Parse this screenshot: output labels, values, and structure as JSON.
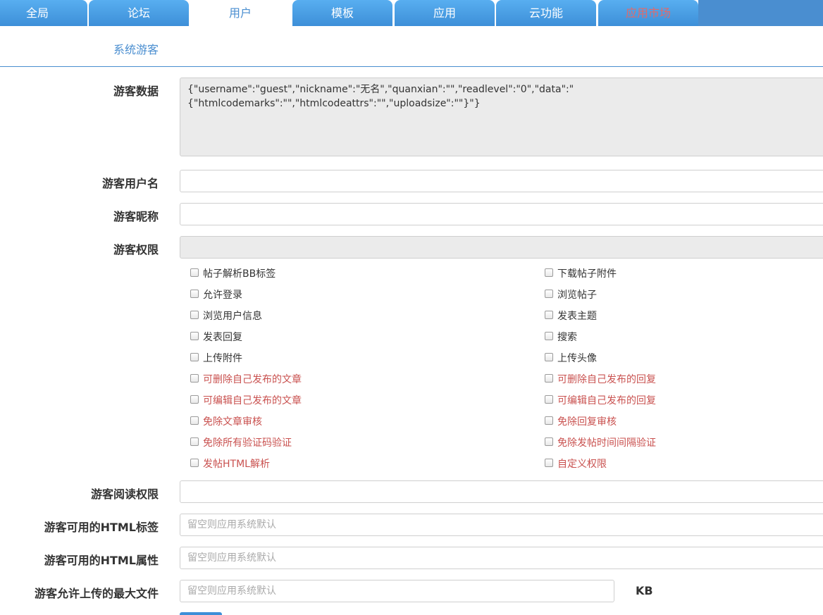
{
  "tabs": [
    {
      "label": "全局",
      "name": "tab-global"
    },
    {
      "label": "论坛",
      "name": "tab-forum"
    },
    {
      "label": "用户",
      "name": "tab-users"
    },
    {
      "label": "模板",
      "name": "tab-templates"
    },
    {
      "label": "应用",
      "name": "tab-apps"
    },
    {
      "label": "云功能",
      "name": "tab-cloud"
    },
    {
      "label": "应用市场",
      "name": "tab-app-market"
    }
  ],
  "active_tab": "用户",
  "section_title": "系统游客",
  "form": {
    "guest_data_label": "游客数据",
    "guest_data_value": "{\"username\":\"guest\",\"nickname\":\"无名\",\"quanxian\":\"\",\"readlevel\":\"0\",\"data\":\"{\"htmlcodemarks\":\"\",\"htmlcodeattrs\":\"\",\"uploadsize\":\"\"}\"}",
    "username_label": "游客用户名",
    "username_value": "",
    "nickname_label": "游客昵称",
    "nickname_value": "",
    "permission_label": "游客权限",
    "permission_value": "",
    "read_level_label": "游客阅读权限",
    "read_level_value": "",
    "html_tags_label": "游客可用的HTML标签",
    "html_tags_placeholder": "留空则应用系统默认",
    "html_attrs_label": "游客可用的HTML属性",
    "html_attrs_placeholder": "留空则应用系统默认",
    "max_upload_label": "游客允许上传的最大文件",
    "max_upload_placeholder": "留空则应用系统默认",
    "max_upload_unit": "KB"
  },
  "permissions_left": [
    {
      "label": "帖子解析BB标签",
      "warn": false
    },
    {
      "label": "允许登录",
      "warn": false
    },
    {
      "label": "浏览用户信息",
      "warn": false
    },
    {
      "label": "发表回复",
      "warn": false
    },
    {
      "label": "上传附件",
      "warn": false
    },
    {
      "label": "可删除自己发布的文章",
      "warn": true
    },
    {
      "label": "可编辑自己发布的文章",
      "warn": true
    },
    {
      "label": "免除文章审核",
      "warn": true
    },
    {
      "label": "免除所有验证码验证",
      "warn": true
    },
    {
      "label": "发帖HTML解析",
      "warn": true
    }
  ],
  "permissions_right": [
    {
      "label": "下载帖子附件",
      "warn": false
    },
    {
      "label": "浏览帖子",
      "warn": false
    },
    {
      "label": "发表主题",
      "warn": false
    },
    {
      "label": "搜索",
      "warn": false
    },
    {
      "label": "上传头像",
      "warn": false
    },
    {
      "label": "可删除自己发布的回复",
      "warn": true
    },
    {
      "label": "可编辑自己发布的回复",
      "warn": true
    },
    {
      "label": "免除回复审核",
      "warn": true
    },
    {
      "label": "免除发帖时间间隔验证",
      "warn": true
    },
    {
      "label": "自定义权限",
      "warn": true
    }
  ],
  "colors": {
    "accent": "#4a8ed0",
    "warn_text": "#c9514f",
    "market_tab": "#e06a6a"
  }
}
